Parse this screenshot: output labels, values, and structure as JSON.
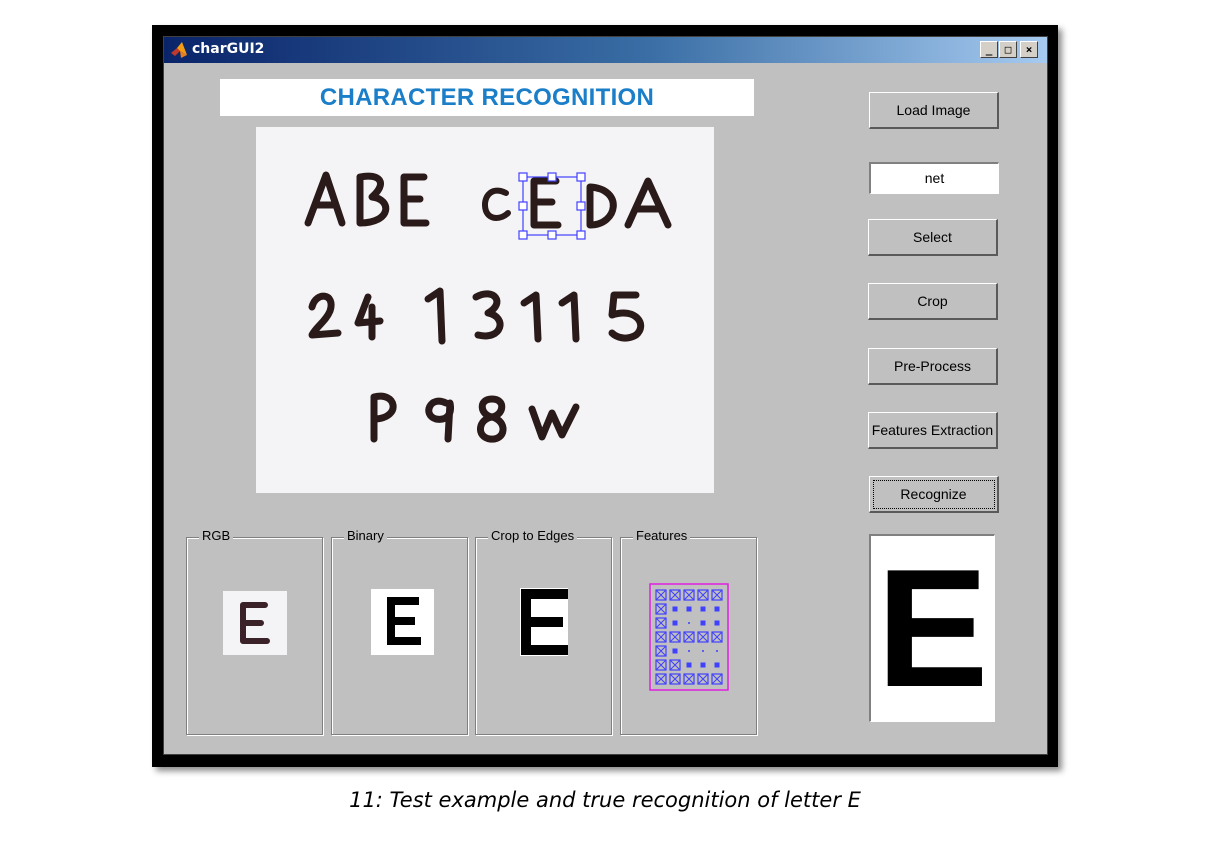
{
  "window": {
    "title": "charGUI2",
    "controls": {
      "minimize": "_",
      "maximize": "□",
      "close": "×"
    }
  },
  "header": {
    "text": "CHARACTER RECOGNITION"
  },
  "main_image": {
    "rows": [
      "ABECEDA",
      "2413115",
      "P98W"
    ],
    "selected_character": "E"
  },
  "buttons": {
    "load_image": "Load Image",
    "select": "Select",
    "crop": "Crop",
    "pre_process": "Pre-Process",
    "features_extraction": "Features Extraction",
    "recognize": "Recognize"
  },
  "network_field": {
    "value": "net"
  },
  "panels": {
    "rgb": "RGB",
    "binary": "Binary",
    "crop_to_edges": "Crop to Edges",
    "features": "Features"
  },
  "thumbnails": {
    "rgb_letter": "E",
    "binary_letter": "E",
    "crop_letter": "E"
  },
  "result": {
    "letter": "E"
  },
  "caption": {
    "text": "11: Test example and true recognition of letter E"
  },
  "colors": {
    "header_text": "#1a7ec8",
    "window_bg": "#c0c0c0",
    "selection_box": "#4040ff",
    "features_border": "#e020e0"
  },
  "icons": [
    "matlab-logo-icon",
    "minimize-icon",
    "maximize-icon",
    "close-icon"
  ]
}
